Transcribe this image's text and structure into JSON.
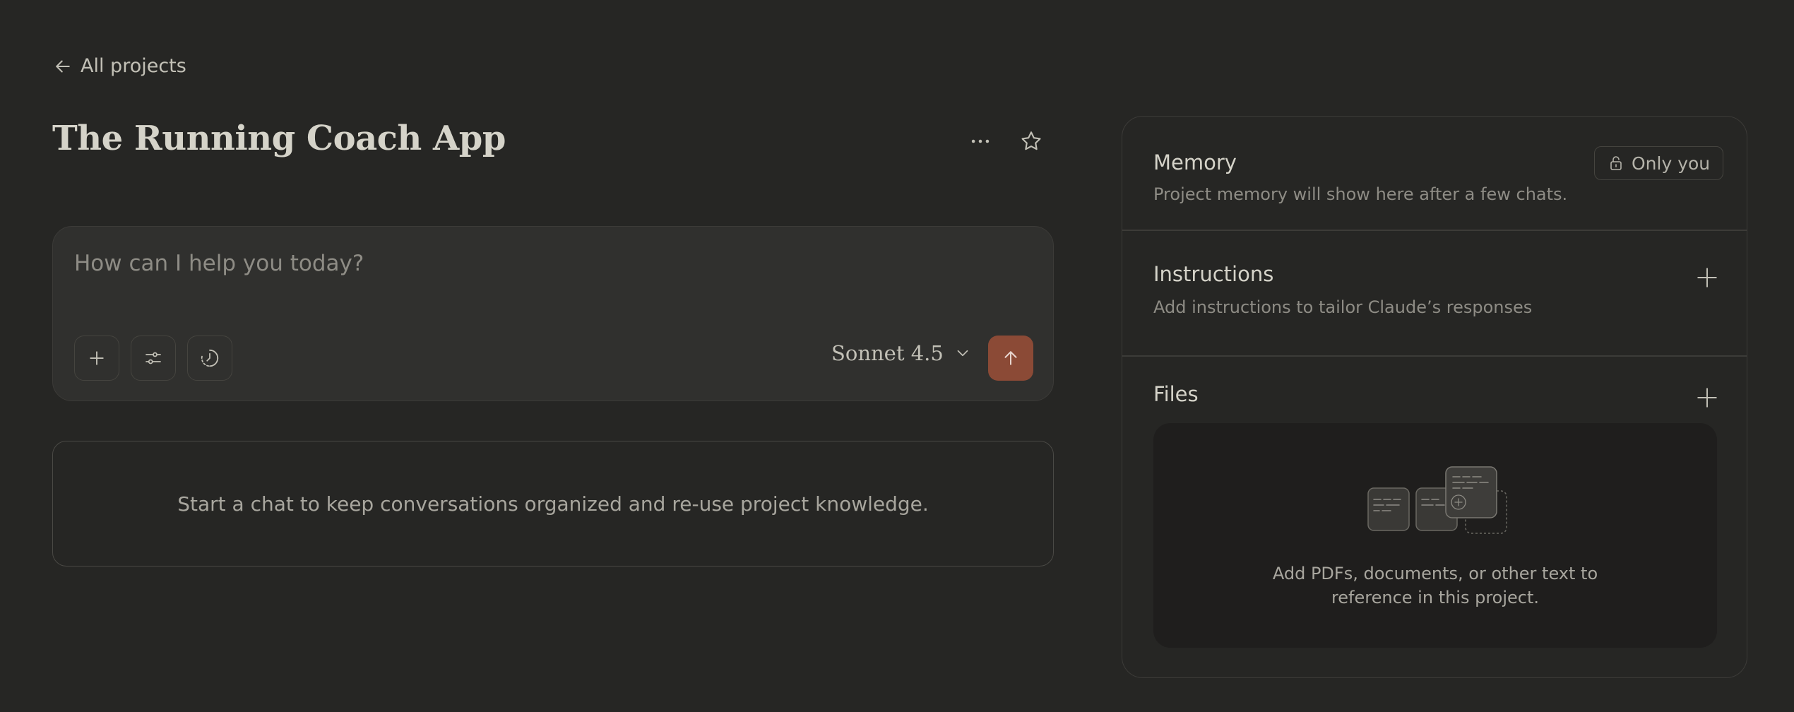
{
  "nav": {
    "back_label": "All projects"
  },
  "project": {
    "title": "The Running Coach App"
  },
  "composer": {
    "placeholder": "How can I help you today?",
    "model": "Sonnet 4.5"
  },
  "empty_state": {
    "text": "Start a chat to keep conversations organized and re-use project knowledge."
  },
  "memory": {
    "title": "Memory",
    "description": "Project memory will show here after a few chats.",
    "visibility": "Only you"
  },
  "instructions": {
    "title": "Instructions",
    "description": "Add instructions to tailor Claude’s responses"
  },
  "files": {
    "title": "Files",
    "empty_line1": "Add PDFs, documents, or other text to",
    "empty_line2": "reference in this project."
  },
  "colors": {
    "background": "#262624",
    "send_accent": "#8b4a36",
    "composer_bg": "#30302e"
  },
  "icons": [
    "arrow-left-icon",
    "more-dots-icon",
    "star-icon",
    "plus-icon",
    "sliders-icon",
    "clock-icon",
    "chevron-down-icon",
    "arrow-up-icon",
    "lock-icon"
  ]
}
